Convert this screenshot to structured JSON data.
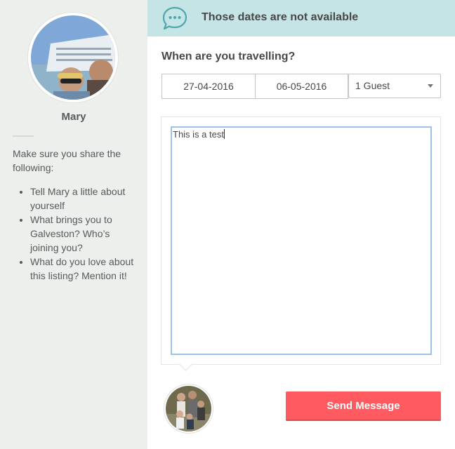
{
  "host": {
    "name": "Mary",
    "intro": "Make sure you share the following:",
    "tips": [
      "Tell Mary a little about yourself",
      "What brings you to Galveston? Who’s joining you?",
      "What do you love about this listing? Mention it!"
    ]
  },
  "banner": {
    "icon": "chat-bubble-icon",
    "message": "Those dates are not available",
    "color": "#c5e4e6"
  },
  "booking": {
    "question": "When are you travelling?",
    "checkin": "27-04-2016",
    "checkout": "06-05-2016",
    "guests": "1 Guest"
  },
  "message": {
    "value": "This is a test"
  },
  "actions": {
    "send_label": "Send Message",
    "send_color": "#ff5a5f"
  }
}
